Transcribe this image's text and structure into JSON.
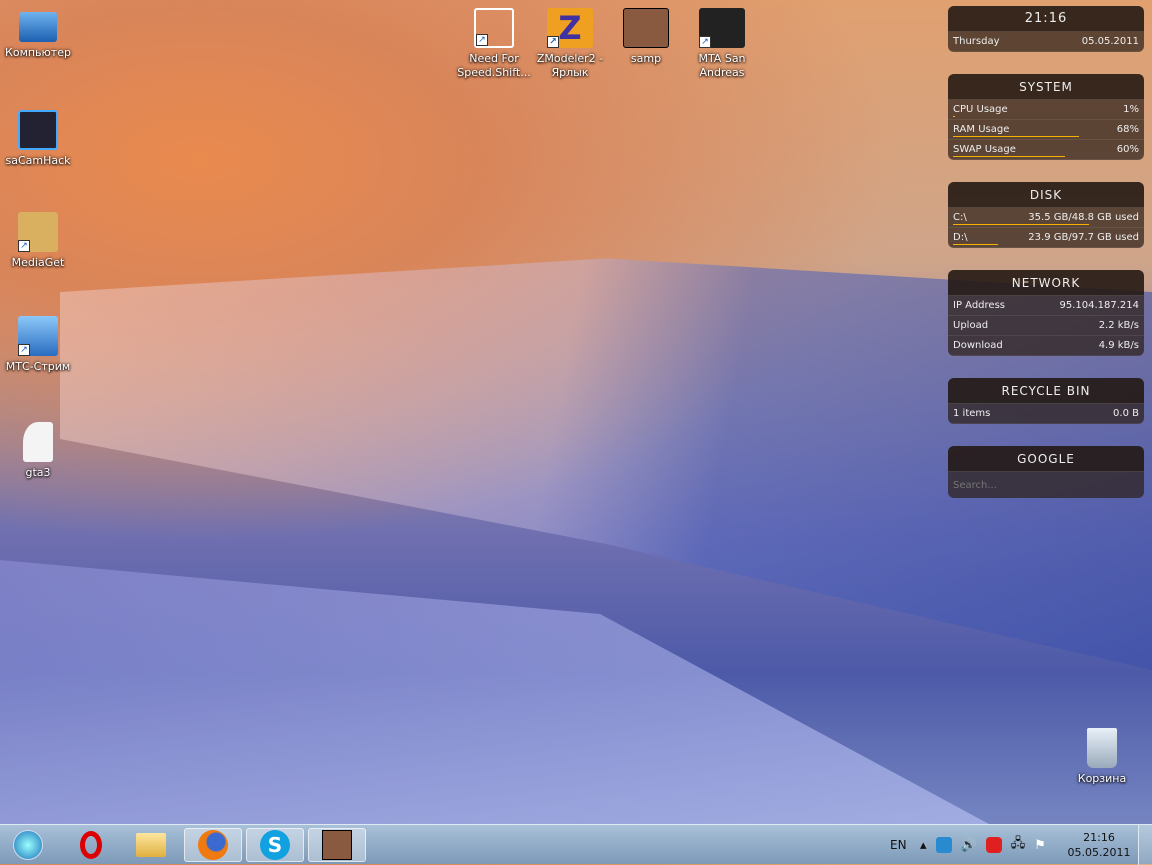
{
  "desktop_icons": [
    {
      "label": "Компьютер",
      "icon": "computer-icon"
    },
    {
      "label": "saCamHack",
      "icon": "camera-icon"
    },
    {
      "label": "MediaGet",
      "icon": "mediaget-icon"
    },
    {
      "label": "МТС-Стрим",
      "icon": "network-computer-icon"
    },
    {
      "label": "gta3",
      "icon": "disc-image-icon"
    },
    {
      "label": "Need For Speed.Shift...",
      "icon": "nfs-icon"
    },
    {
      "label": "ZModeler2 - Ярлык",
      "icon": "zmodeler-icon"
    },
    {
      "label": "samp",
      "icon": "samp-icon"
    },
    {
      "label": "MTA San Andreas",
      "icon": "mta-icon"
    },
    {
      "label": "Корзина",
      "icon": "recycle-bin-icon"
    }
  ],
  "clock": {
    "time": "21:16",
    "day": "Thursday",
    "date": "05.05.2011"
  },
  "system": {
    "title": "SYSTEM",
    "rows": [
      {
        "label": "CPU Usage",
        "value": "1%",
        "percent": 1
      },
      {
        "label": "RAM Usage",
        "value": "68%",
        "percent": 68
      },
      {
        "label": "SWAP Usage",
        "value": "60%",
        "percent": 60
      }
    ]
  },
  "disk": {
    "title": "DISK",
    "rows": [
      {
        "label": "C:\\",
        "value": "35.5 GB/48.8 GB used",
        "percent": 73
      },
      {
        "label": "D:\\",
        "value": "23.9 GB/97.7 GB used",
        "percent": 24
      }
    ]
  },
  "network": {
    "title": "NETWORK",
    "rows": [
      {
        "label": "IP Address",
        "value": "95.104.187.214"
      },
      {
        "label": "Upload",
        "value": "2.2 kB/s"
      },
      {
        "label": "Download",
        "value": "4.9 kB/s"
      }
    ]
  },
  "recycle": {
    "title": "RECYCLE BIN",
    "items": "1 items",
    "size": "0.0 B"
  },
  "google": {
    "title": "GOOGLE",
    "placeholder": "Search..."
  },
  "taskbar": {
    "lang": "EN",
    "time": "21:16",
    "date": "05.05.2011",
    "accent": "#f5b000"
  }
}
